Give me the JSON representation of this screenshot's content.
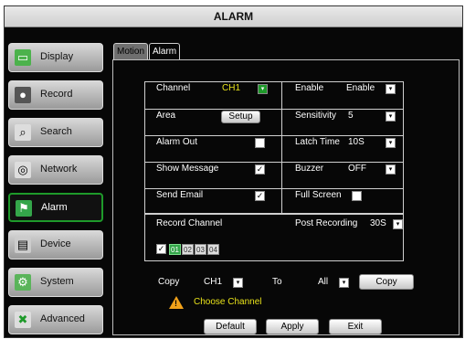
{
  "window": {
    "title": "ALARM"
  },
  "sidebar": {
    "items": [
      {
        "label": "Display",
        "icon": "monitor-icon"
      },
      {
        "label": "Record",
        "icon": "camera-icon"
      },
      {
        "label": "Search",
        "icon": "magnifier-icon"
      },
      {
        "label": "Network",
        "icon": "globe-icon"
      },
      {
        "label": "Alarm",
        "icon": "alarm-icon"
      },
      {
        "label": "Device",
        "icon": "device-icon"
      },
      {
        "label": "System",
        "icon": "system-icon"
      },
      {
        "label": "Advanced",
        "icon": "tools-icon"
      }
    ],
    "active": "Alarm"
  },
  "tabs": [
    {
      "label": "Motion"
    },
    {
      "label": "Alarm"
    }
  ],
  "settings": {
    "channel_label": "Channel",
    "channel_value": "CH1",
    "enable_label": "Enable",
    "enable_value": "Enable",
    "area_label": "Area",
    "setup_label": "Setup",
    "sensitivity_label": "Sensitivity",
    "sensitivity_value": "5",
    "alarm_out_label": "Alarm Out",
    "latch_time_label": "Latch Time",
    "latch_time_value": "10S",
    "show_message_label": "Show Message",
    "buzzer_label": "Buzzer",
    "buzzer_value": "OFF",
    "send_email_label": "Send Email",
    "full_screen_label": "Full Screen",
    "alarm_out_checked": false,
    "show_message_checked": true,
    "send_email_checked": true,
    "full_screen_checked": false
  },
  "record": {
    "record_channel_label": "Record Channel",
    "post_recording_label": "Post Recording",
    "post_recording_value": "30S",
    "channels": [
      "01",
      "02",
      "03",
      "04"
    ],
    "selected_channels": [
      "01"
    ]
  },
  "copy_row": {
    "copy_label": "Copy",
    "from_value": "CH1",
    "to_label": "To",
    "to_value": "All",
    "copy_button": "Copy",
    "warning_text": "Choose Channel"
  },
  "footer": {
    "default_button": "Default",
    "apply_button": "Apply",
    "exit_button": "Exit"
  },
  "colors": {
    "accent_green": "#1e9a2a",
    "warning_yellow": "#e8e21a",
    "background": "#070707"
  }
}
